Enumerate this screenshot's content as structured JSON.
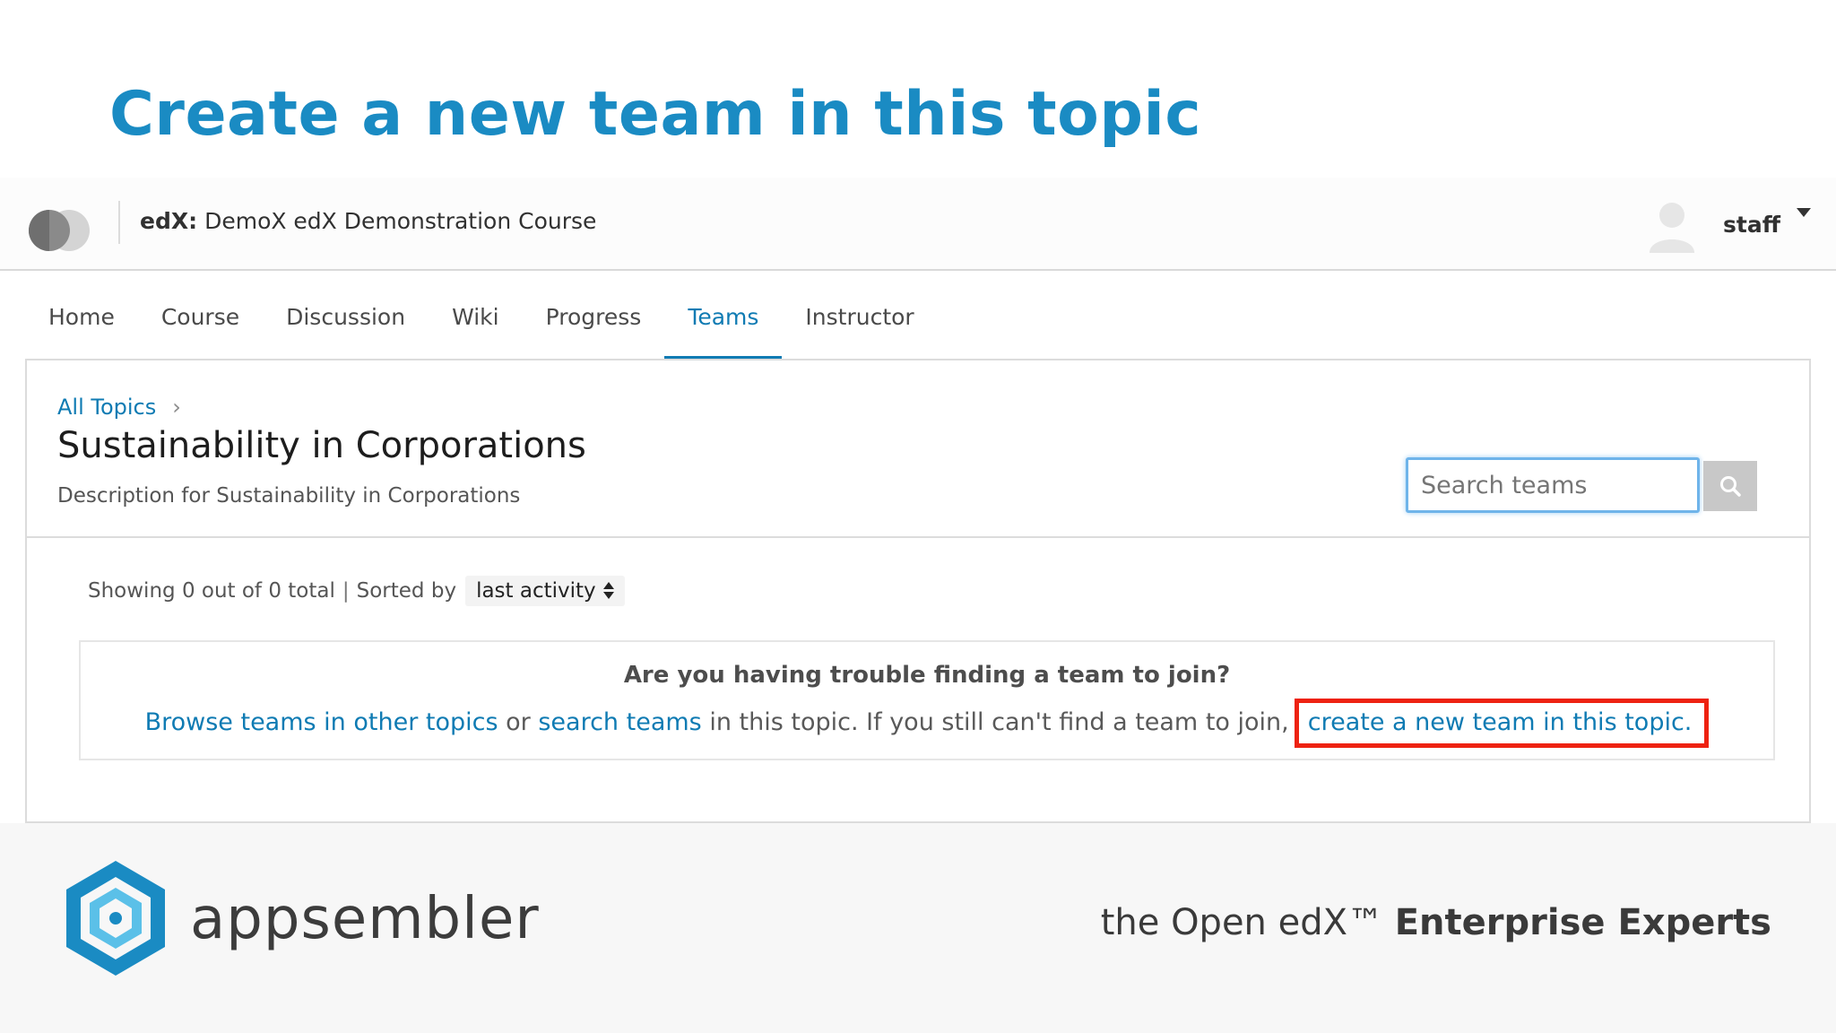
{
  "slide": {
    "title": "Create a new team in this topic"
  },
  "header": {
    "org": "edX:",
    "course": "DemoX edX Demonstration Course",
    "username": "staff"
  },
  "tabs": [
    {
      "label": "Home",
      "active": false
    },
    {
      "label": "Course",
      "active": false
    },
    {
      "label": "Discussion",
      "active": false
    },
    {
      "label": "Wiki",
      "active": false
    },
    {
      "label": "Progress",
      "active": false
    },
    {
      "label": "Teams",
      "active": true
    },
    {
      "label": "Instructor",
      "active": false
    }
  ],
  "topic": {
    "breadcrumb": "All Topics",
    "breadcrumb_sep": "›",
    "title": "Sustainability in Corporations",
    "description": "Description for Sustainability in Corporations"
  },
  "search": {
    "placeholder": "Search teams"
  },
  "results": {
    "showing": "Showing 0 out of 0 total",
    "separator": "|",
    "sorted_by": "Sorted by",
    "sort_value": "last activity"
  },
  "help": {
    "question": "Are you having trouble finding a team to join?",
    "browse_link": "Browse teams in other topics",
    "or": "or",
    "search_link": "search teams",
    "middle_text": "in this topic. If you still can't find a team to join,",
    "create_link": "create a new team in this topic."
  },
  "footer": {
    "brand": "appsembler",
    "tagline_prefix": "the Open edX™",
    "tagline_bold": "Enterprise Experts"
  },
  "colors": {
    "accent": "#0f7bb3",
    "title": "#1a8bc3",
    "highlight": "#ee2211"
  }
}
